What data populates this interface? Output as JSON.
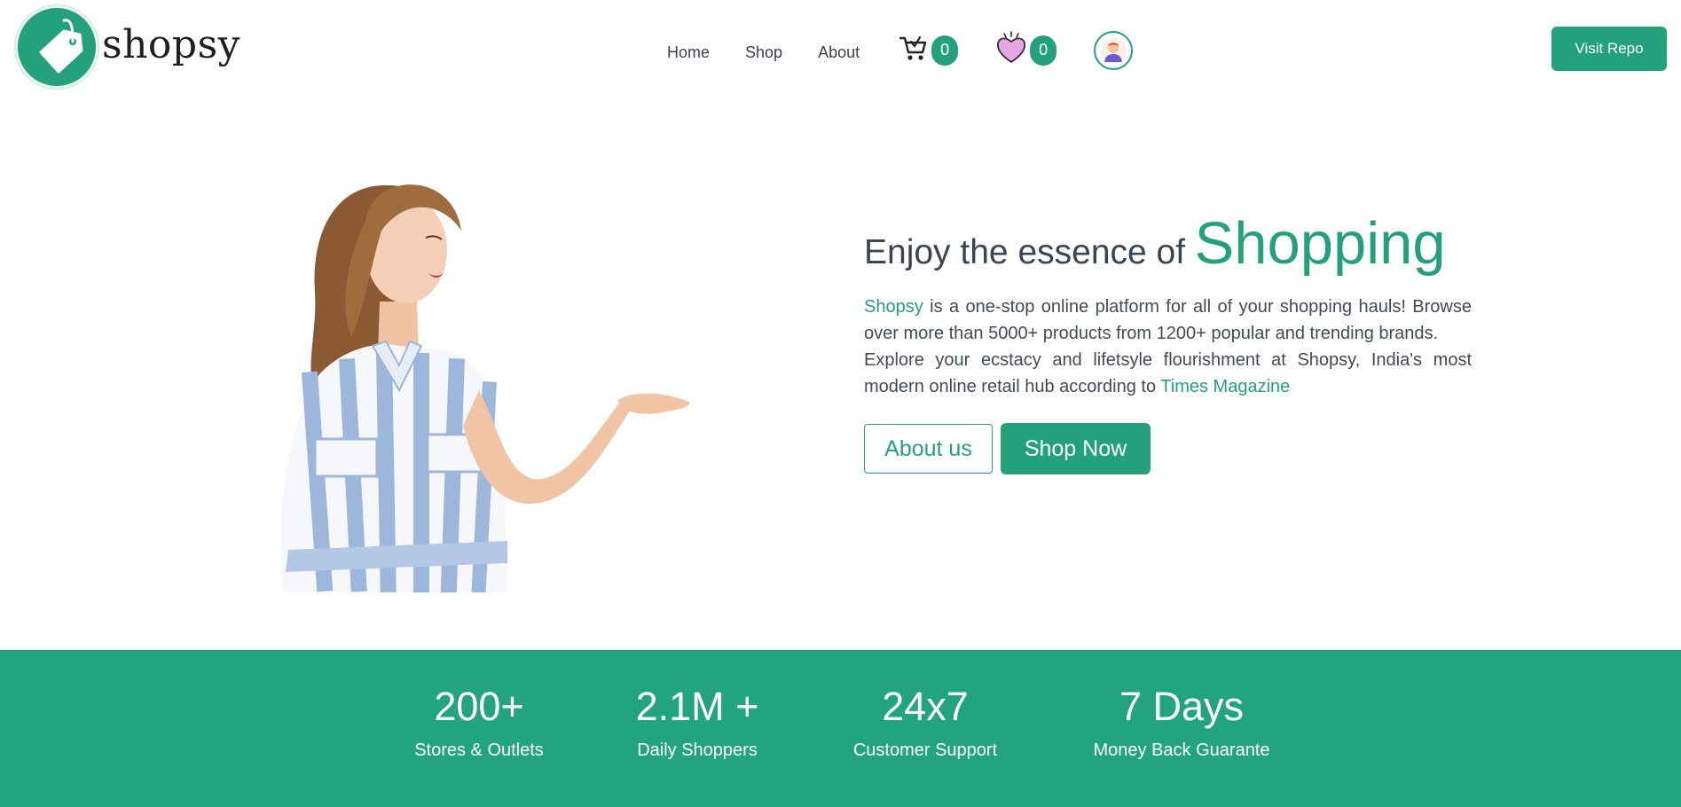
{
  "brand": {
    "name": "shopsy",
    "color": "#22a17a"
  },
  "nav": {
    "links": [
      "Home",
      "Shop",
      "About"
    ],
    "cart": {
      "icon": "cart-icon",
      "count": "0"
    },
    "wishlist": {
      "icon": "heart-icon",
      "count": "0"
    },
    "profile": {
      "icon": "avatar-icon"
    },
    "repo_button": "Visit Repo"
  },
  "hero": {
    "headline_lead": "Enjoy the essence of",
    "headline_accent": "Shopping",
    "p1_brand": "Shopsy",
    "p1_rest": " is a one-stop online platform for all of your shopping hauls! Browse over more than 5000+ products from 1200+ popular and trending brands.",
    "p2_text": "Explore your ecstacy and lifetsyle flourishment at Shopsy, India's most modern online retail hub according to ",
    "p2_link": "Times Magazine",
    "about_button": "About us",
    "shop_button": "Shop Now"
  },
  "stats": [
    {
      "value": "200+",
      "label": "Stores & Outlets"
    },
    {
      "value": "2.1M +",
      "label": "Daily Shoppers"
    },
    {
      "value": "24x7",
      "label": "Customer Support"
    },
    {
      "value": "7 Days",
      "label": "Money Back Guarante"
    }
  ]
}
